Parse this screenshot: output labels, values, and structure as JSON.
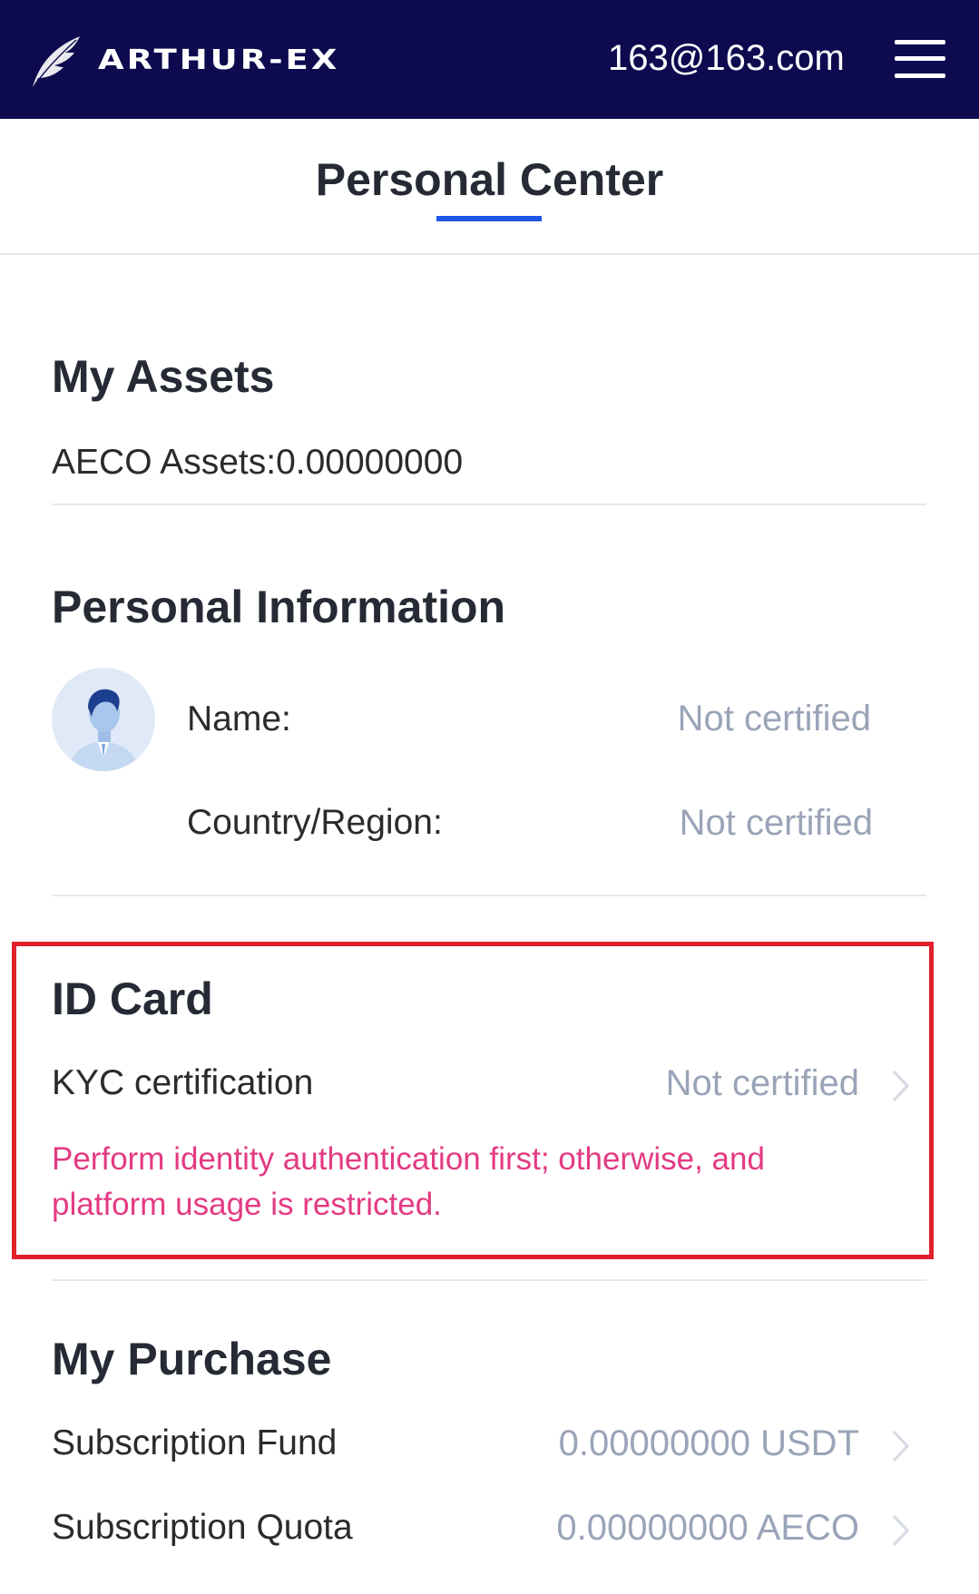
{
  "header": {
    "logo_text": "ARTHUR-EX",
    "email": "163@163.com",
    "menu_icon": "hamburger-menu-icon",
    "background": "#0d0a4f"
  },
  "tabs": [
    {
      "label": "Personal Center",
      "active": true
    }
  ],
  "accent_color": "#1e56e8",
  "my_assets": {
    "title": "My Assets",
    "aeco_assets": "AECO Assets:0.00000000"
  },
  "personal_info": {
    "title": "Personal Information",
    "avatar_icon": "user-avatar-icon",
    "name_label": "Name:",
    "name_value": "Not certified",
    "region_label": "Country/Region:",
    "region_value": "Not certified"
  },
  "id_card": {
    "title": "ID Card",
    "kyc_label": "KYC certification",
    "kyc_status": "Not certified",
    "warning": "Perform identity authentication first; otherwise, and platform usage is restricted.",
    "warning_color": "#e33a83",
    "highlight_color": "#e0202b"
  },
  "my_purchase": {
    "title": "My Purchase",
    "fund_label": "Subscription Fund",
    "fund_value": "0.00000000 USDT",
    "quota_label": "Subscription Quota",
    "quota_value": "0.00000000 AECO"
  }
}
